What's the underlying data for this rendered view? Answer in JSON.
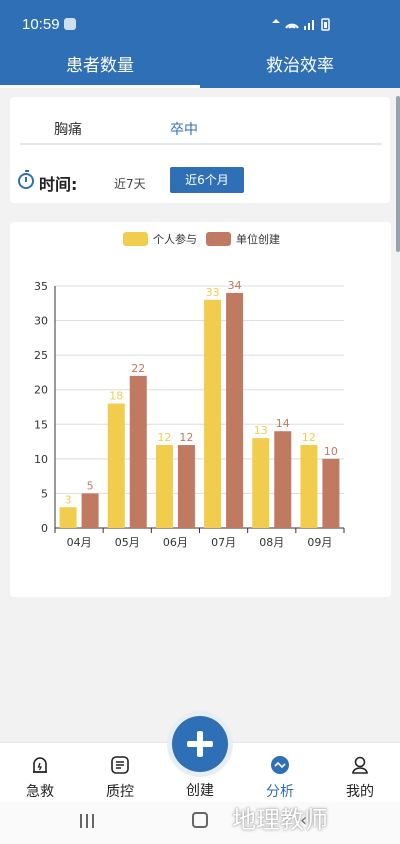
{
  "status_bar": {
    "time": "10:59",
    "system_icons": "wifi-icon signal-icon battery-icon"
  },
  "tabs": [
    {
      "label": "患者数量",
      "active": true
    },
    {
      "label": "救治效率",
      "active": false
    }
  ],
  "filters": {
    "types": [
      {
        "label": "胸痛",
        "selected": false
      },
      {
        "label": "卒中",
        "selected": true
      }
    ],
    "time_label": "时间:",
    "ranges": [
      {
        "label": "近7天",
        "selected": false
      },
      {
        "label": "近6个月",
        "selected": true
      }
    ]
  },
  "colors": {
    "brand": "#2f6fb5",
    "series_personal": "#f2cc4d",
    "series_unit": "#c07a62"
  },
  "chart_data": {
    "type": "bar",
    "categories": [
      "04月",
      "05月",
      "06月",
      "07月",
      "08月",
      "09月"
    ],
    "series": [
      {
        "name": "个人参与",
        "values": [
          3,
          18,
          12,
          33,
          13,
          12
        ]
      },
      {
        "name": "单位创建",
        "values": [
          5,
          22,
          12,
          34,
          14,
          10
        ]
      }
    ],
    "yticks": [
      0,
      5,
      10,
      15,
      20,
      25,
      30,
      35
    ],
    "ylim": [
      0,
      35
    ],
    "grid": true,
    "legend": "top"
  },
  "bottom_nav": {
    "items": [
      {
        "label": "急救",
        "icon": "emergency-icon",
        "active": false
      },
      {
        "label": "质控",
        "icon": "quality-control-icon",
        "active": false
      },
      {
        "label": "分析",
        "icon": "analysis-icon",
        "active": true
      },
      {
        "label": "我的",
        "icon": "profile-icon",
        "active": false
      }
    ],
    "create": {
      "label": "创建",
      "icon": "plus-icon"
    }
  },
  "watermark": "地理教师"
}
